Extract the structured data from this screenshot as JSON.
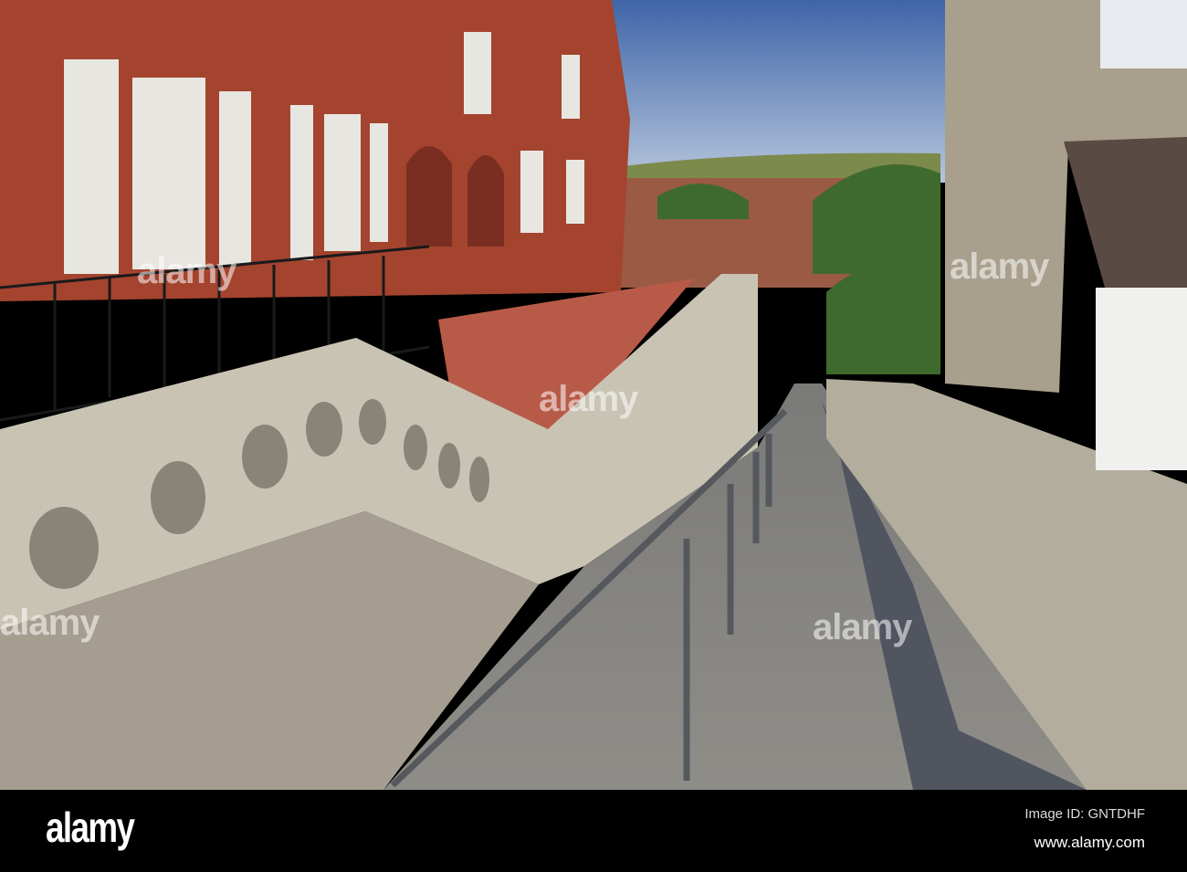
{
  "photo": {
    "subject": "Stone-walled footpath descending beside a red brick building with balustrade and handrail"
  },
  "watermark": {
    "text": "alamy"
  },
  "footer": {
    "logo": "alamy",
    "image_id": "Image ID: GNTDHF",
    "website": "www.alamy.com"
  }
}
